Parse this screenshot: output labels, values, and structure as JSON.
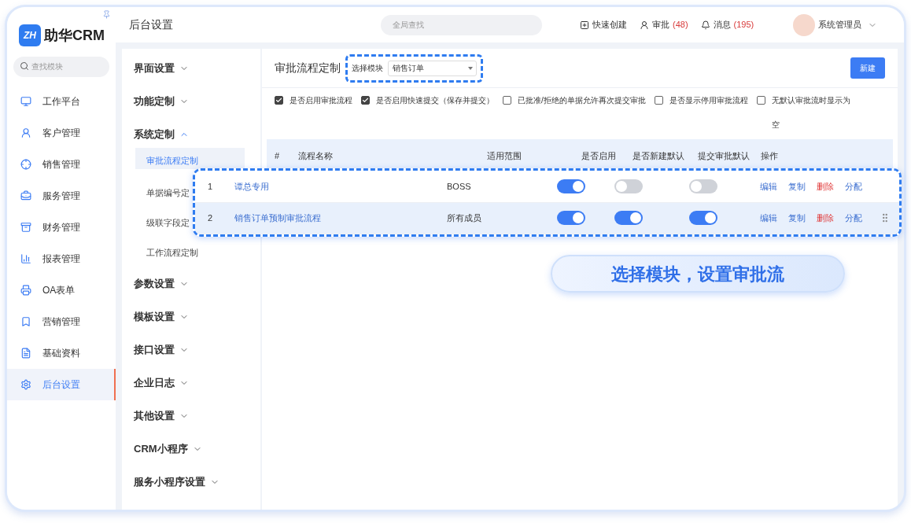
{
  "logo": {
    "mark": "ZH",
    "name": "助华CRM"
  },
  "sidebar": {
    "search": {
      "placeholder": "查找模块"
    },
    "items": [
      {
        "label": "工作平台",
        "selected": false
      },
      {
        "label": "客户管理",
        "selected": false
      },
      {
        "label": "销售管理",
        "selected": false
      },
      {
        "label": "服务管理",
        "selected": false
      },
      {
        "label": "财务管理",
        "selected": false
      },
      {
        "label": "报表管理",
        "selected": false
      },
      {
        "label": "OA表单",
        "selected": false
      },
      {
        "label": "营销管理",
        "selected": false
      },
      {
        "label": "基础资料",
        "selected": false
      },
      {
        "label": "后台设置",
        "selected": true
      }
    ]
  },
  "topbar": {
    "title": "后台设置",
    "search": {
      "placeholder": "全局查找"
    },
    "actions": [
      {
        "label": "快速创建"
      },
      {
        "label": "审批",
        "count": "(48)"
      },
      {
        "label": "消息",
        "count": "(195)"
      }
    ],
    "user": "系统管理员"
  },
  "submenu": [
    {
      "label": "界面设置",
      "expanded": false
    },
    {
      "label": "功能定制",
      "expanded": false
    },
    {
      "label": "系统定制",
      "expanded": true,
      "children": [
        {
          "label": "审批流程定制",
          "selected": true
        },
        {
          "label": "单据编号定",
          "selected": false
        },
        {
          "label": "级联字段定",
          "selected": false
        },
        {
          "label": "工作流程定制",
          "selected": false
        }
      ]
    },
    {
      "label": "参数设置",
      "expanded": false
    },
    {
      "label": "模板设置",
      "expanded": false
    },
    {
      "label": "接口设置",
      "expanded": false
    },
    {
      "label": "企业日志",
      "expanded": false
    },
    {
      "label": "其他设置",
      "expanded": false
    },
    {
      "label": "CRM小程序",
      "expanded": false
    },
    {
      "label": "服务小程序设置",
      "expanded": false
    }
  ],
  "main": {
    "title": "审批流程定制",
    "module_select": {
      "label": "选择模块",
      "value": "销售订单"
    },
    "new_button": "新建",
    "options": [
      {
        "label": "是否启用审批流程",
        "checked": true
      },
      {
        "label": "是否启用快速提交（保存并提交）",
        "checked": true
      },
      {
        "label": "已批准/拒绝的单据允许再次提交审批",
        "checked": false
      },
      {
        "label": "是否显示停用审批流程",
        "checked": false
      },
      {
        "label": "无默认审批流时显示为空",
        "checked": false
      }
    ],
    "table": {
      "columns": [
        "#",
        "流程名称",
        "适用范围",
        "是否启用",
        "是否新建默认",
        "提交审批默认",
        "操作"
      ],
      "rows": [
        {
          "index": "1",
          "name": "谭总专用",
          "scope": "BOSS",
          "enabled": true,
          "default_new": false,
          "default_submit": false,
          "selected": false,
          "actions": [
            {
              "label": "编辑",
              "kind": "link"
            },
            {
              "label": "复制",
              "kind": "link"
            },
            {
              "label": "删除",
              "kind": "danger"
            },
            {
              "label": "分配",
              "kind": "link"
            }
          ]
        },
        {
          "index": "2",
          "name": "销售订单预制审批流程",
          "scope": "所有成员",
          "enabled": true,
          "default_new": true,
          "default_submit": true,
          "selected": true,
          "actions": [
            {
              "label": "编辑",
              "kind": "link"
            },
            {
              "label": "复制",
              "kind": "link"
            },
            {
              "label": "删除",
              "kind": "danger"
            },
            {
              "label": "分配",
              "kind": "link"
            }
          ]
        }
      ]
    }
  },
  "callout": "选择模块，设置审批流"
}
